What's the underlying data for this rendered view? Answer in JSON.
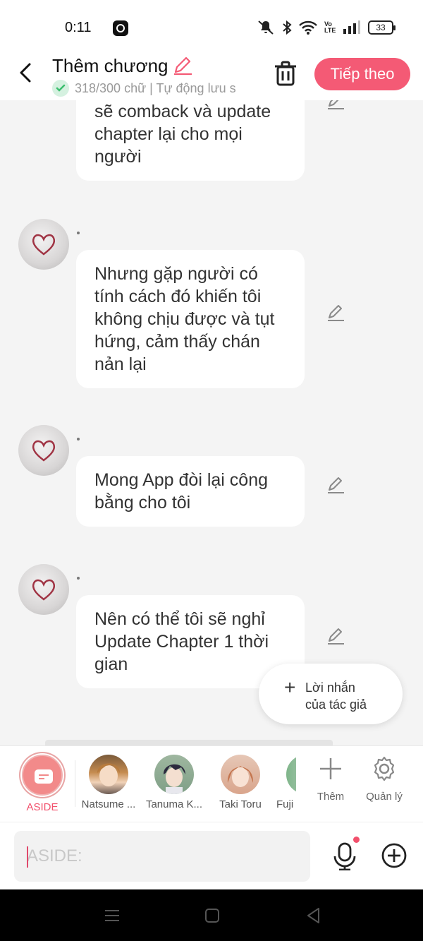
{
  "status_bar": {
    "time": "0:11",
    "battery": "33",
    "icons": [
      "app-notification-icon",
      "mute-icon",
      "bluetooth-icon",
      "wifi-icon",
      "volte-icon",
      "signal-icon",
      "battery-icon"
    ],
    "volte_text": "Vo LTE"
  },
  "header": {
    "title": "Thêm chương",
    "subtitle": "318/300 chữ | Tự động lưu s",
    "next_label": "Tiếp theo",
    "accent": "#f45a75"
  },
  "messages": [
    {
      "text": "sẽ comback và update chapter lại cho mọi người",
      "has_avatar": false
    },
    {
      "text": "Nhưng gặp người có tính cách đó khiến tôi không chịu được và tụt hứng, cảm thấy chán nản lại",
      "has_avatar": true,
      "name": "."
    },
    {
      "text": "Mong App đòi lại công bằng cho tôi",
      "has_avatar": true,
      "name": "."
    },
    {
      "text": "Nên có thể tôi sẽ nghỉ Update Chapter 1 thời gian",
      "has_avatar": true,
      "name": "."
    }
  ],
  "author_note": {
    "line1": "Lời nhắn",
    "line2": "của tác giả"
  },
  "characters": [
    {
      "label": "ASIDE"
    },
    {
      "label": "Natsume ..."
    },
    {
      "label": "Tanuma K..."
    },
    {
      "label": "Taki Toru"
    },
    {
      "label": "Fuji"
    }
  ],
  "tools": {
    "add_label": "Thêm",
    "manage_label": "Quản lý"
  },
  "input": {
    "placeholder": "ASIDE:",
    "value": ""
  }
}
